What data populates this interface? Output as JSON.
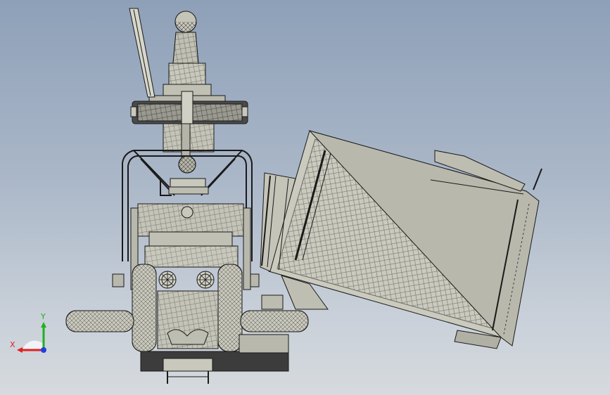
{
  "viewport": {
    "background_top": "#8ea0b8",
    "background_bottom": "#d6dade",
    "model_fill": "#c8c8bc",
    "model_dark": "#3c3c3c",
    "edge_color": "#1a1a1a"
  },
  "triad": {
    "x_label": "X",
    "y_label": "Y",
    "x_color": "#e02020",
    "y_color": "#20b020",
    "z_color": "#2040e0"
  }
}
